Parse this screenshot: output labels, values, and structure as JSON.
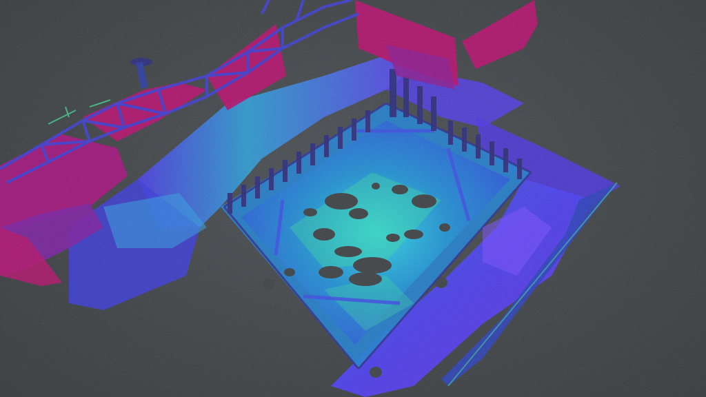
{
  "viewer": {
    "background_color": "#3c4043",
    "colormap": [
      "#2a1a8c",
      "#3a2ed6",
      "#5a3cf0",
      "#8a2fb8",
      "#b0106a",
      "#1f8fd0",
      "#2fd0e0",
      "#3de39a"
    ]
  }
}
